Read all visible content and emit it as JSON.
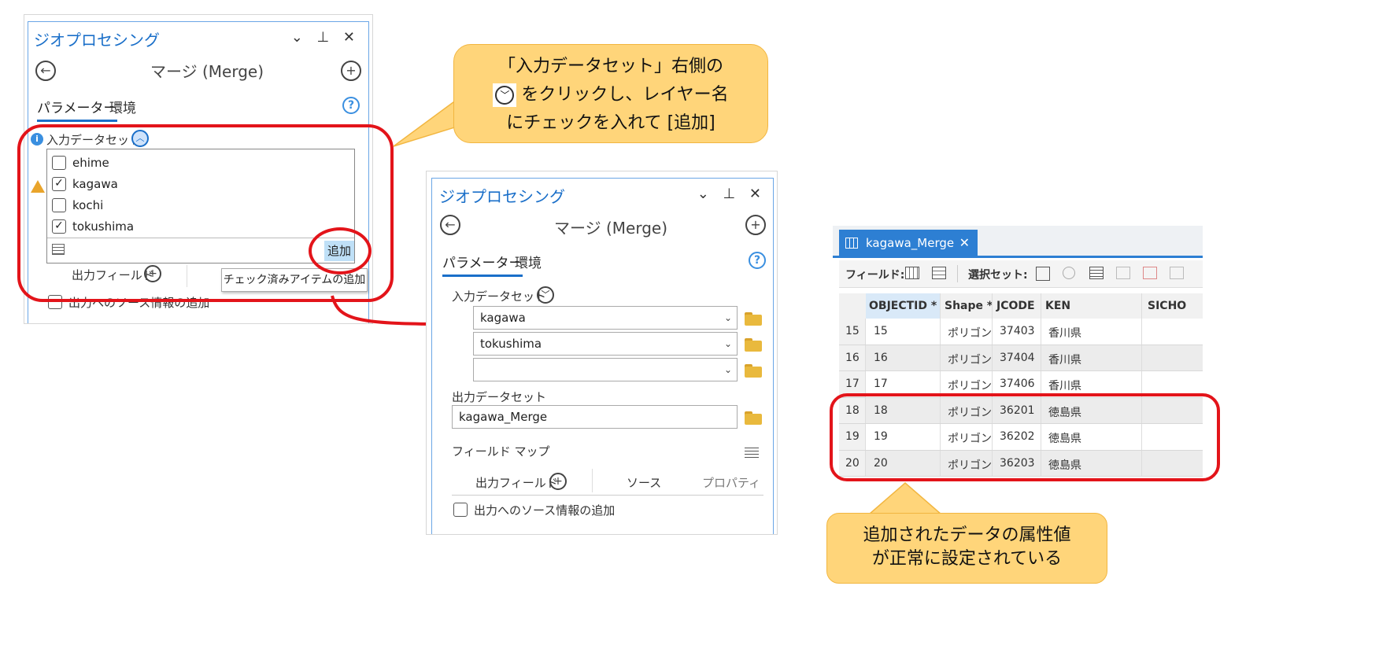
{
  "callout_top": {
    "line1": "「入力データセット」右側の",
    "line2": "をクリックし、レイヤー名",
    "line3": "にチェックを入れて [追加]"
  },
  "callout_bottom": {
    "line1": "追加されたデータの属性値",
    "line2": "が正常に設定されている"
  },
  "left_panel": {
    "title": "ジオプロセシング",
    "window_controls": "⌄ ᵖ ✕",
    "tool_title": "マージ (Merge)",
    "tabs": [
      "パラメーター",
      "環境"
    ],
    "input_label": "入力データセット",
    "items": [
      {
        "label": "ehime",
        "checked": false
      },
      {
        "label": "kagawa",
        "checked": true
      },
      {
        "label": "kochi",
        "checked": false
      },
      {
        "label": "tokushima",
        "checked": true
      }
    ],
    "add_button": "追加",
    "output_fields": "出力フィールド",
    "tooltip": "チェック済みアイテムの追加",
    "source_info": "出力へのソース情報の追加"
  },
  "middle_panel": {
    "title": "ジオプロセシング",
    "tool_title": "マージ (Merge)",
    "tabs": [
      "パラメーター",
      "環境"
    ],
    "input_label": "入力データセット",
    "inputs": [
      "kagawa",
      "tokushima",
      ""
    ],
    "output_label": "出力データセット",
    "output_value": "kagawa_Merge",
    "field_map_label": "フィールド マップ",
    "output_fields": "出力フィールド",
    "source_tab": "ソース",
    "property_tab": "プロパティ",
    "source_info": "出力へのソース情報の追加"
  },
  "table": {
    "tab_name": "kagawa_Merge",
    "field_label": "フィールド:",
    "selection_label": "選択セット:",
    "columns": [
      "OBJECTID *",
      "Shape *",
      "JCODE",
      "KEN",
      "SICHO"
    ],
    "rows": [
      {
        "row": "15",
        "objectid": "15",
        "shape": "ポリゴン",
        "jcode": "37403",
        "ken": "香川県",
        "sicho": ""
      },
      {
        "row": "16",
        "objectid": "16",
        "shape": "ポリゴン",
        "jcode": "37404",
        "ken": "香川県",
        "sicho": ""
      },
      {
        "row": "17",
        "objectid": "17",
        "shape": "ポリゴン",
        "jcode": "37406",
        "ken": "香川県",
        "sicho": ""
      },
      {
        "row": "18",
        "objectid": "18",
        "shape": "ポリゴン",
        "jcode": "36201",
        "ken": "徳島県",
        "sicho": ""
      },
      {
        "row": "19",
        "objectid": "19",
        "shape": "ポリゴン",
        "jcode": "36202",
        "ken": "徳島県",
        "sicho": ""
      },
      {
        "row": "20",
        "objectid": "20",
        "shape": "ポリゴン",
        "jcode": "36203",
        "ken": "徳島県",
        "sicho": ""
      }
    ]
  },
  "colors": {
    "accent": "#1a6fc9",
    "highlight_red": "#e3141a",
    "callout_fill": "#ffd57a",
    "callout_border": "#f2b640"
  }
}
